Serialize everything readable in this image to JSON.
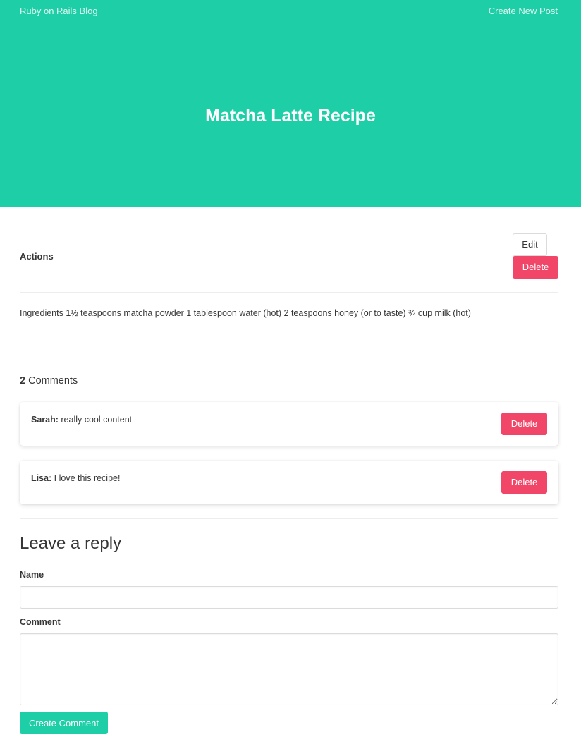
{
  "nav": {
    "brand": "Ruby on Rails Blog",
    "create_new_post": "Create New Post"
  },
  "post": {
    "title": "Matcha Latte Recipe",
    "actions_label": "Actions",
    "edit_label": "Edit",
    "delete_label": "Delete",
    "body": "Ingredients 1½ teaspoons matcha powder 1 tablespoon water (hot) 2 teaspoons honey (or to taste) ¾ cup milk (hot)"
  },
  "comments": {
    "count": "2",
    "count_label": "Comments",
    "items": [
      {
        "author": "Sarah:",
        "text": "really cool content",
        "delete_label": "Delete"
      },
      {
        "author": "Lisa:",
        "text": "I love this recipe!",
        "delete_label": "Delete"
      }
    ]
  },
  "reply": {
    "title": "Leave a reply",
    "name_label": "Name",
    "name_value": "",
    "comment_label": "Comment",
    "comment_value": "",
    "submit_label": "Create Comment"
  },
  "colors": {
    "primary": "#1dcea6",
    "danger": "#f14668",
    "text": "#363636",
    "border": "#dbdbdb"
  }
}
